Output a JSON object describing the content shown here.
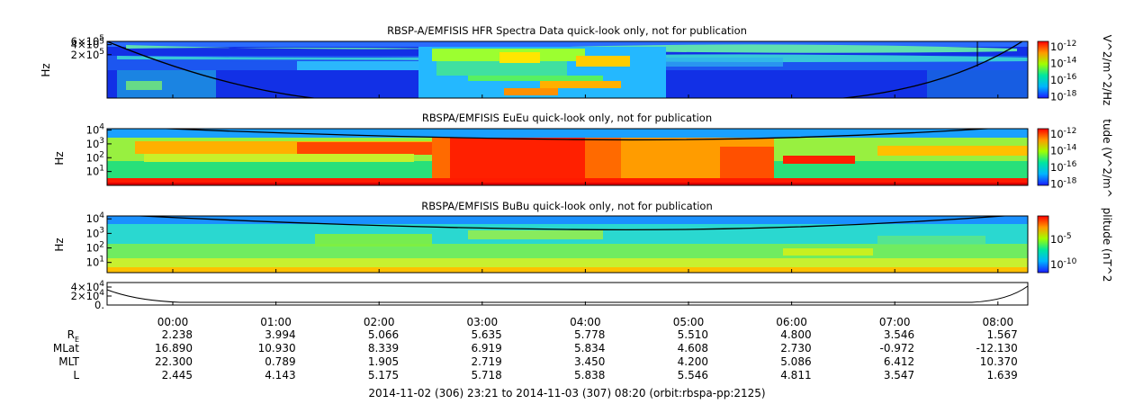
{
  "footer": "2014-11-02 (306) 23:21 to 2014-11-03 (307) 08:20 (orbit:rbspa-pp:2125)",
  "time_ticks": [
    "00:00",
    "01:00",
    "02:00",
    "03:00",
    "04:00",
    "05:00",
    "06:00",
    "07:00",
    "08:00"
  ],
  "ephemeris": [
    {
      "label": "R",
      "sub": "E",
      "values": [
        "2.238",
        "3.994",
        "5.066",
        "5.635",
        "5.778",
        "5.510",
        "4.800",
        "3.546",
        "1.567"
      ]
    },
    {
      "label": "MLat",
      "values": [
        "16.890",
        "10.930",
        "8.339",
        "6.919",
        "5.834",
        "4.608",
        "2.730",
        "-0.972",
        "-12.130"
      ]
    },
    {
      "label": "MLT",
      "values": [
        "22.300",
        "0.789",
        "1.905",
        "2.719",
        "3.450",
        "4.200",
        "5.086",
        "6.412",
        "10.370"
      ]
    },
    {
      "label": "L",
      "values": [
        "2.445",
        "4.143",
        "5.175",
        "5.718",
        "5.838",
        "5.546",
        "4.811",
        "3.547",
        "1.639"
      ]
    }
  ],
  "chart_data": [
    {
      "type": "heatmap",
      "title": "RBSP-A/EMFISIS  HFR Spectra Data quick-look only, not for publication",
      "ylabel": "Hz",
      "yticks": [
        {
          "value": 200000,
          "mant": "2×10",
          "exp": "5"
        },
        {
          "value": 400000,
          "mant": "4×10",
          "exp": "5"
        },
        {
          "value": 600000,
          "mant": "6×10",
          "exp": "5"
        }
      ],
      "ylim": [
        10000,
        500000
      ],
      "colorbar_label": "V^2/m^2/Hz",
      "colorbar_ticks": [
        {
          "mant": "10",
          "exp": "-12"
        },
        {
          "mant": "10",
          "exp": "-14"
        },
        {
          "mant": "10",
          "exp": "-16"
        },
        {
          "mant": "10",
          "exp": "-18"
        }
      ]
    },
    {
      "type": "heatmap",
      "title": "RBSPA/EMFISIS  EuEu quick-look only, not for publication",
      "ylabel": "Hz",
      "yticks": [
        {
          "value": 10000,
          "mant": "10",
          "exp": "4"
        },
        {
          "value": 1000,
          "mant": "10",
          "exp": "3"
        },
        {
          "value": 100,
          "mant": "10",
          "exp": "2"
        },
        {
          "value": 10,
          "mant": "10",
          "exp": "1"
        }
      ],
      "colorbar_label": "tude (V^2/m^",
      "colorbar_ticks": [
        {
          "mant": "10",
          "exp": "-12"
        },
        {
          "mant": "10",
          "exp": "-14"
        },
        {
          "mant": "10",
          "exp": "-16"
        },
        {
          "mant": "10",
          "exp": "-18"
        }
      ]
    },
    {
      "type": "heatmap",
      "title": "RBSPA/EMFISIS  BuBu quick-look only, not for publication",
      "ylabel": "Hz",
      "yticks": [
        {
          "value": 10000,
          "mant": "10",
          "exp": "4"
        },
        {
          "value": 1000,
          "mant": "10",
          "exp": "3"
        },
        {
          "value": 100,
          "mant": "10",
          "exp": "2"
        },
        {
          "value": 10,
          "mant": "10",
          "exp": "1"
        }
      ],
      "colorbar_label": "plitude (nT^2",
      "colorbar_ticks": [
        {
          "mant": "10",
          "exp": "-5"
        },
        {
          "mant": "10",
          "exp": "-10"
        }
      ]
    },
    {
      "type": "line",
      "yticks": [
        {
          "value": 40000,
          "mant": "4×10",
          "exp": "4"
        },
        {
          "value": 20000,
          "mant": "2×10",
          "exp": "4"
        },
        {
          "value": 0,
          "mant": "0.",
          "exp": ""
        }
      ],
      "ylim": [
        0,
        50000
      ]
    }
  ]
}
